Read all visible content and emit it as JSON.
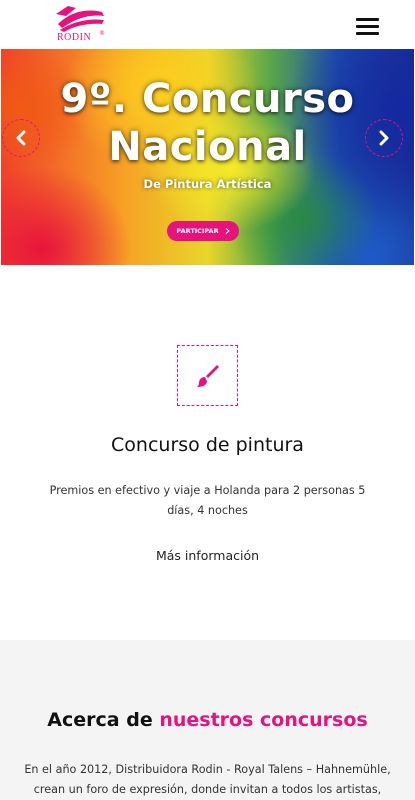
{
  "header": {
    "logo_text": "RODIN",
    "logo_reg": "®",
    "menu_icon": "hamburger-menu-icon"
  },
  "hero": {
    "title_line1": "9º. Concurso",
    "title_line2": "Nacional",
    "subtitle": "De Pintura Artística",
    "button_label": "PARTICIPAR",
    "button_icon": "chevron-right-icon",
    "prev_icon": "chevron-left-icon",
    "next_icon": "chevron-right-icon",
    "colors": {
      "accent": "#e6127d"
    }
  },
  "feature": {
    "icon": "paintbrush-icon",
    "title": "Concurso de pintura",
    "description": "Premios en efectivo y viaje a Holanda para 2 personas 5 días, 4 noches",
    "link_label": "Más información"
  },
  "about": {
    "title_prefix": "Acerca de",
    "title_accent": "nuestros concursos",
    "text": "En el año 2012, Distribuidora Rodin - Royal Talens – Hahnemühle, crean un foro de expresión, donde invitan a todos los artistas, aficionados"
  },
  "colors": {
    "brand": "#e6127d",
    "section_bg": "#f4f4f4"
  }
}
